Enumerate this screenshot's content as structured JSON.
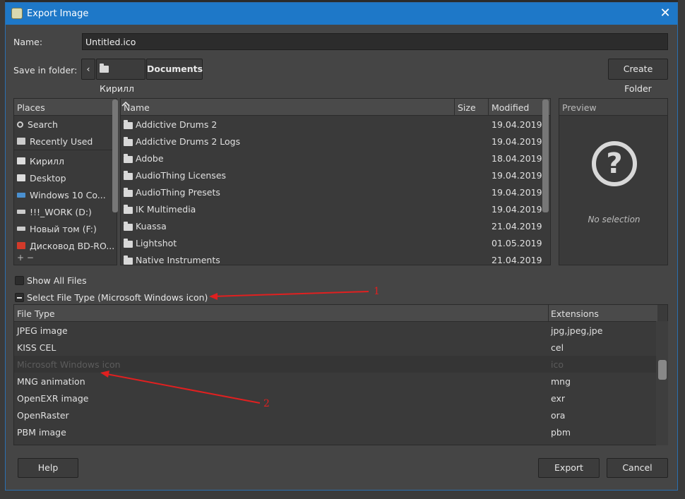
{
  "window": {
    "title": "Export Image",
    "close_glyph": "✕"
  },
  "name_label": "Name:",
  "name_value": "Untitled.ico",
  "folder_label": "Save in folder:",
  "breadcrumbs": {
    "back_glyph": "‹",
    "user": "Кирилл",
    "current": "Documents"
  },
  "create_folder_label": "Create Folder",
  "places": {
    "header": "Places",
    "items": [
      {
        "label": "Search",
        "icon": "search-icon"
      },
      {
        "label": "Recently Used",
        "icon": "recent-icon"
      },
      {
        "label": "Кирилл",
        "icon": "folder-icon"
      },
      {
        "label": "Desktop",
        "icon": "folder-icon"
      },
      {
        "label": "Windows 10 Co...",
        "icon": "drive-icon"
      },
      {
        "label": "!!!_WORK (D:)",
        "icon": "disk-icon"
      },
      {
        "label": "Новый том (F:)",
        "icon": "disk-icon"
      },
      {
        "label": "Дисковод BD-RO...",
        "icon": "disc-icon"
      }
    ],
    "footer": "+ −"
  },
  "files": {
    "columns": {
      "name": "Name",
      "size": "Size",
      "modified": "Modified"
    },
    "rows": [
      {
        "name": "Addictive Drums 2",
        "modified": "19.04.2019"
      },
      {
        "name": "Addictive Drums 2 Logs",
        "modified": "19.04.2019"
      },
      {
        "name": "Adobe",
        "modified": "18.04.2019"
      },
      {
        "name": "AudioThing Licenses",
        "modified": "19.04.2019"
      },
      {
        "name": "AudioThing Presets",
        "modified": "19.04.2019"
      },
      {
        "name": "IK Multimedia",
        "modified": "19.04.2019"
      },
      {
        "name": "Kuassa",
        "modified": "21.04.2019"
      },
      {
        "name": "Lightshot",
        "modified": "01.05.2019"
      },
      {
        "name": "Native Instruments",
        "modified": "21.04.2019"
      }
    ]
  },
  "preview": {
    "header": "Preview",
    "glyph": "?",
    "empty_text": "No selection"
  },
  "show_all_files_label": "Show All Files",
  "select_file_type_label": "Select File Type (Microsoft Windows icon)",
  "file_types": {
    "columns": {
      "type": "File Type",
      "ext": "Extensions"
    },
    "rows": [
      {
        "type": "JPEG image",
        "ext": "jpg,jpeg,jpe"
      },
      {
        "type": "KISS CEL",
        "ext": "cel"
      },
      {
        "type": "Microsoft Windows icon",
        "ext": "ico"
      },
      {
        "type": "MNG animation",
        "ext": "mng"
      },
      {
        "type": "OpenEXR image",
        "ext": "exr"
      },
      {
        "type": "OpenRaster",
        "ext": "ora"
      },
      {
        "type": "PBM image",
        "ext": "pbm"
      }
    ],
    "selected_index": 2
  },
  "buttons": {
    "help": "Help",
    "export": "Export",
    "cancel": "Cancel"
  },
  "annotations": {
    "one": "1",
    "two": "2"
  },
  "colors": {
    "accent": "#1e78c8",
    "annotation": "#e02020"
  }
}
